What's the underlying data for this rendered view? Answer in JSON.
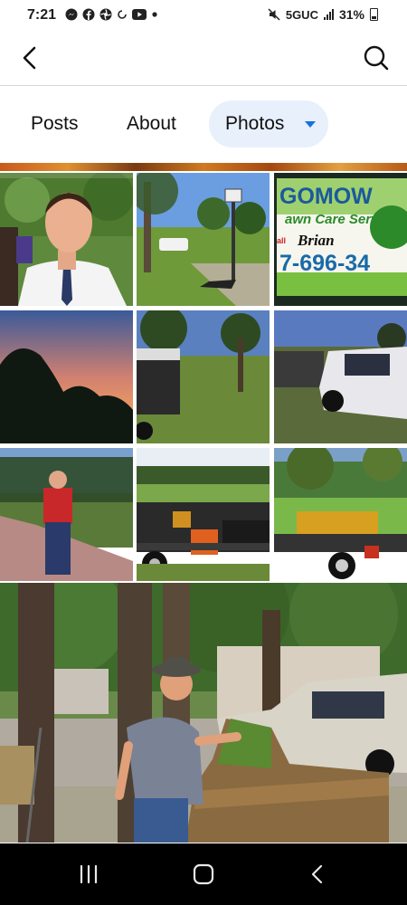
{
  "status_bar": {
    "time": "7:21",
    "network": "5GUC",
    "battery": "31%",
    "notification_icons": [
      "messenger-icon",
      "facebook-icon",
      "pinwheel-icon",
      "sync-icon",
      "youtube-icon",
      "dot-icon"
    ]
  },
  "header": {
    "back_icon": "chevron-left-icon",
    "search_icon": "search-icon"
  },
  "tabs": [
    {
      "label": "Posts",
      "selected": false
    },
    {
      "label": "About",
      "selected": false
    },
    {
      "label": "Photos",
      "selected": true
    }
  ],
  "photos": {
    "sign_text_line1": "GOMOW",
    "sign_text_line2": "awn Care Servi",
    "sign_text_line3": "Brian",
    "sign_text_line4": "7-696-34",
    "sign_text_small": "all"
  },
  "colors": {
    "accent": "#1a6fe0",
    "tab_selected_bg": "#e7f0fb",
    "nav_bar_bg": "#000000"
  }
}
